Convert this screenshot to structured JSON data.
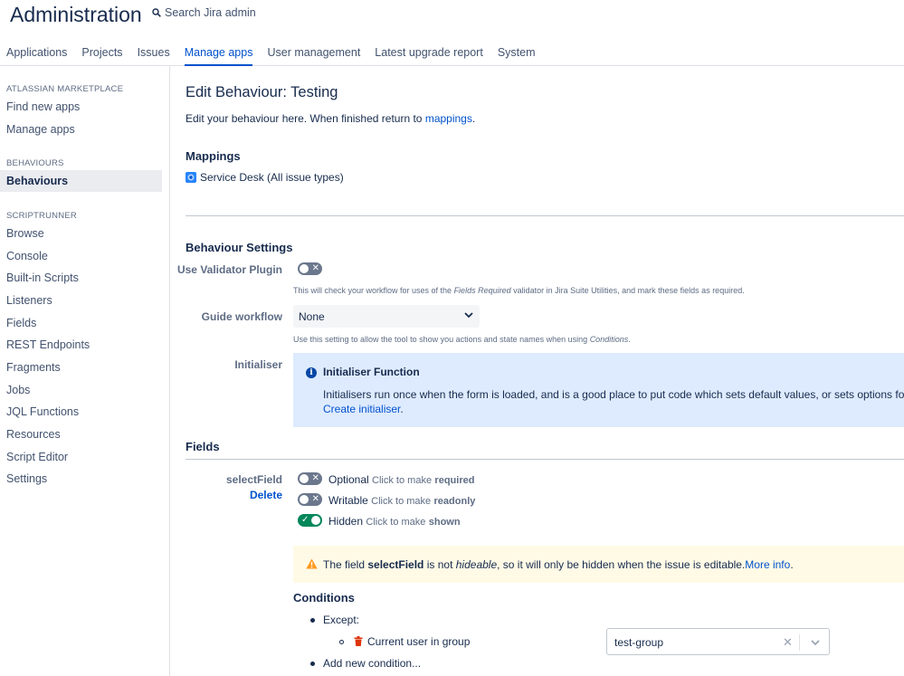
{
  "header": {
    "title": "Administration",
    "search_label": "Search Jira admin"
  },
  "tabs": [
    {
      "label": "Applications"
    },
    {
      "label": "Projects"
    },
    {
      "label": "Issues"
    },
    {
      "label": "Manage apps"
    },
    {
      "label": "User management"
    },
    {
      "label": "Latest upgrade report"
    },
    {
      "label": "System"
    }
  ],
  "sidebar": {
    "sections": [
      {
        "heading": "ATLASSIAN MARKETPLACE",
        "items": [
          "Find new apps",
          "Manage apps"
        ]
      },
      {
        "heading": "BEHAVIOURS",
        "items": [
          "Behaviours"
        ]
      },
      {
        "heading": "SCRIPTRUNNER",
        "items": [
          "Browse",
          "Console",
          "Built-in Scripts",
          "Listeners",
          "Fields",
          "REST Endpoints",
          "Fragments",
          "Jobs",
          "JQL Functions",
          "Resources",
          "Script Editor",
          "Settings"
        ]
      }
    ]
  },
  "page": {
    "title": "Edit Behaviour: Testing",
    "intro_text": "Edit your behaviour here. When finished return to",
    "intro_link": "mappings",
    "intro_end": "."
  },
  "mappings": {
    "heading": "Mappings",
    "item": "Service Desk (All issue types)"
  },
  "settings": {
    "heading": "Behaviour Settings",
    "validator_label": "Use Validator Plugin",
    "validator_help_pre": "This will check your workflow for uses of the ",
    "validator_help_em": "Fields Required",
    "validator_help_post": " validator in Jira Suite Utilities, and mark these fields as required.",
    "guide_label": "Guide workflow",
    "guide_value": "None",
    "guide_help_pre": "Use this setting to allow the tool to show you actions and state names when using ",
    "guide_help_em": "Conditions",
    "guide_help_post": ".",
    "initialiser_label": "Initialiser",
    "initialiser_title": "Initialiser Function",
    "initialiser_text": "Initialisers run once when the form is loaded, and is a good place to put code which sets default values, or sets options for insta",
    "initialiser_link": "Create initialiser",
    "initialiser_link_end": "."
  },
  "fields": {
    "heading": "Fields",
    "field_name": "selectField",
    "delete_label": "Delete",
    "statuses": [
      {
        "state": "Optional",
        "hint": "Click to make",
        "target": "required",
        "on": false
      },
      {
        "state": "Writable",
        "hint": "Click to make",
        "target": "readonly",
        "on": false
      },
      {
        "state": "Hidden",
        "hint": "Click to make",
        "target": "shown",
        "on": true
      }
    ],
    "warning": {
      "pre": "The field ",
      "field": "selectField",
      "mid": " is not ",
      "em": "hideable",
      "post": ", so it will only be hidden when the issue is editable.",
      "link": "More info",
      "end": "."
    }
  },
  "conditions": {
    "heading": "Conditions",
    "except_label": "Except:",
    "condition_label": "Current user in group",
    "group_value": "test-group",
    "add_label": "Add new condition..."
  },
  "colors": {
    "accent": "#0052cc",
    "toggle_on": "#00875a",
    "info_bg": "#deebff",
    "warn_bg": "#fffae6",
    "trash": "#de350b"
  },
  "icons": {
    "search": "search-icon",
    "info": "info-icon",
    "warning": "warning-icon",
    "trash": "trash-icon",
    "service_desk": "service-desk-icon",
    "chevron": "chevron-down-icon",
    "clear": "clear-icon"
  }
}
